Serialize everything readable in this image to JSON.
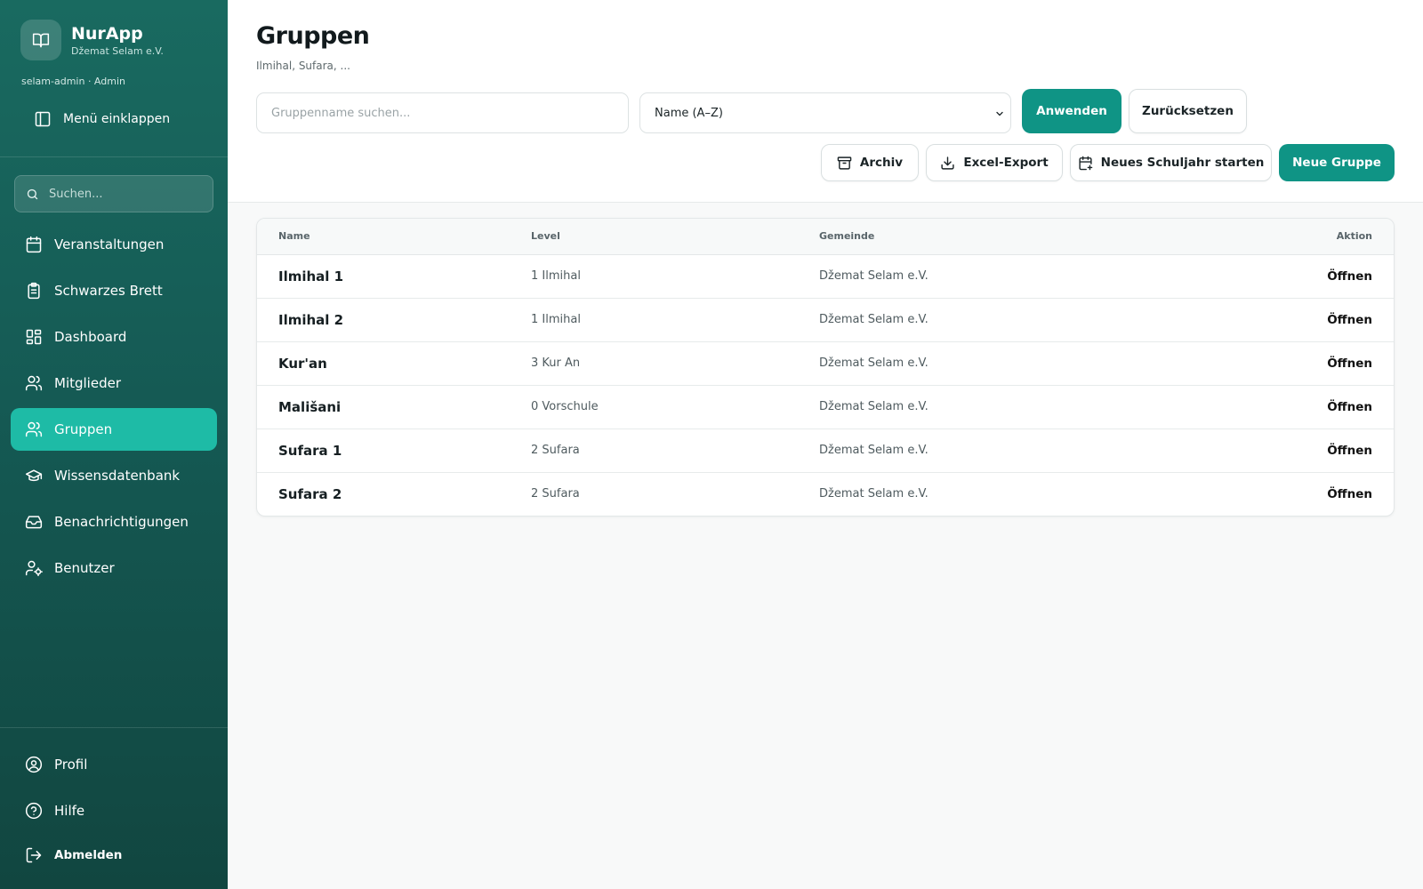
{
  "app": {
    "name": "NurApp",
    "org": "Džemat Selam e.V.",
    "user_line": "selam-admin · Admin",
    "collapse_label": "Menü einklappen"
  },
  "sidebar": {
    "search_placeholder": "Suchen...",
    "items": [
      {
        "label": "Veranstaltungen",
        "icon": "calendar-icon",
        "active": false
      },
      {
        "label": "Schwarzes Brett",
        "icon": "clipboard-icon",
        "active": false
      },
      {
        "label": "Dashboard",
        "icon": "dashboard-grid-icon",
        "active": false
      },
      {
        "label": "Mitglieder",
        "icon": "users-icon",
        "active": false
      },
      {
        "label": "Gruppen",
        "icon": "users-icon",
        "active": true
      },
      {
        "label": "Wissensdatenbank",
        "icon": "graduation-cap-icon",
        "active": false
      },
      {
        "label": "Benachrichtigungen",
        "icon": "inbox-icon",
        "active": false
      },
      {
        "label": "Benutzer",
        "icon": "user-cog-icon",
        "active": false
      }
    ],
    "bottom": [
      {
        "label": "Profil",
        "icon": "user-circle-icon"
      },
      {
        "label": "Hilfe",
        "icon": "help-circle-icon"
      },
      {
        "label": "Abmelden",
        "icon": "logout-icon"
      }
    ]
  },
  "page": {
    "title": "Gruppen",
    "subtitle": "Ilmihal, Sufara, ..."
  },
  "filters": {
    "search_placeholder": "Gruppenname suchen...",
    "search_value": "",
    "sort_value": "Name (A–Z)",
    "apply_label": "Anwenden",
    "reset_label": "Zurücksetzen"
  },
  "actions": {
    "archive_label": "Archiv",
    "export_label": "Excel-Export",
    "new_year_label": "Neues Schuljahr starten",
    "new_group_label": "Neue Gruppe"
  },
  "table": {
    "headers": {
      "name": "Name",
      "level": "Level",
      "gemeinde": "Gemeinde",
      "action": "Aktion"
    },
    "rows": [
      {
        "name": "Ilmihal 1",
        "level": "1 Ilmihal",
        "gemeinde": "Džemat Selam e.V.",
        "action": "Öffnen"
      },
      {
        "name": "Ilmihal 2",
        "level": "1 Ilmihal",
        "gemeinde": "Džemat Selam e.V.",
        "action": "Öffnen"
      },
      {
        "name": "Kur'an",
        "level": "3 Kur An",
        "gemeinde": "Džemat Selam e.V.",
        "action": "Öffnen"
      },
      {
        "name": "Mališani",
        "level": "0 Vorschule",
        "gemeinde": "Džemat Selam e.V.",
        "action": "Öffnen"
      },
      {
        "name": "Sufara 1",
        "level": "2 Sufara",
        "gemeinde": "Džemat Selam e.V.",
        "action": "Öffnen"
      },
      {
        "name": "Sufara 2",
        "level": "2 Sufara",
        "gemeinde": "Džemat Selam e.V.",
        "action": "Öffnen"
      }
    ]
  },
  "colors": {
    "sidebar": "#196a60",
    "active": "#1ebba6",
    "primary": "#0f9485"
  }
}
